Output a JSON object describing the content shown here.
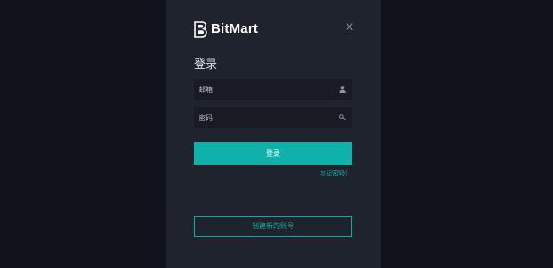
{
  "brand": {
    "name": "BitMart",
    "logo_icon": "bitmart-logo-icon"
  },
  "dialog": {
    "close_label": "X",
    "title": "登录"
  },
  "email_field": {
    "placeholder": "邮箱",
    "value": "",
    "icon": "user-icon"
  },
  "password_field": {
    "placeholder": "密码",
    "value": "",
    "icon": "key-icon"
  },
  "actions": {
    "login_label": "登录",
    "forgot_label": "忘记密码？",
    "create_label": "创建新的账号"
  },
  "colors": {
    "background": "#10131b",
    "panel": "#1f232d",
    "input_bg": "#181b23",
    "accent": "#0fb1ab"
  }
}
